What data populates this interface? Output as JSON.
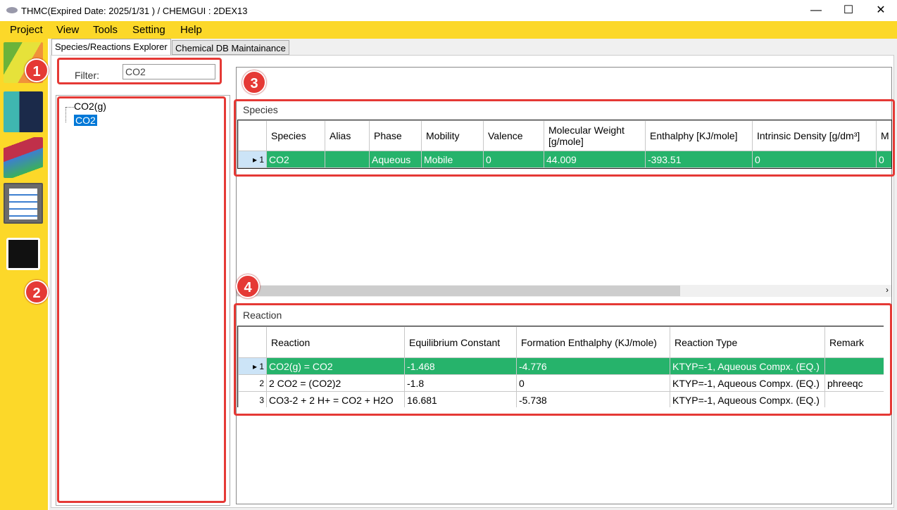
{
  "window": {
    "title": "THMC(Expired Date: 2025/1/31 ) / CHEMGUI : 2DEX13",
    "minimize": "—",
    "maximize": "☐",
    "close": "✕"
  },
  "menu": [
    "Project",
    "View",
    "Tools",
    "Setting",
    "Help"
  ],
  "tabs": [
    "Species/Reactions Explorer",
    "Chemical DB Maintainance"
  ],
  "filter": {
    "label": "Filter:",
    "value": "CO2"
  },
  "tree": [
    "CO2(g)",
    "CO2"
  ],
  "badges": [
    "1",
    "2",
    "3",
    "4"
  ],
  "species": {
    "title": "Species",
    "columns": [
      "Species",
      "Alias",
      "Phase",
      "Mobility",
      "Valence",
      "Molecular Weight [g/mole]",
      "Enthalphy [KJ/mole]",
      "Intrinsic Density [g/dm³]",
      "M [d"
    ],
    "rows": [
      {
        "index": "1",
        "cells": [
          "CO2",
          "",
          "Aqueous",
          "Mobile",
          "0",
          "44.009",
          "-393.51",
          "0",
          "0"
        ]
      }
    ]
  },
  "reaction": {
    "title": "Reaction",
    "columns": [
      "Reaction",
      "Equilibrium Constant",
      "Formation Enthalphy (KJ/mole)",
      "Reaction Type",
      "Remark"
    ],
    "rows": [
      {
        "index": "1",
        "cells": [
          "CO2(g) = CO2",
          "-1.468",
          "-4.776",
          "KTYP=-1, Aqueous Compx. (EQ.)",
          ""
        ]
      },
      {
        "index": "2",
        "cells": [
          "2 CO2 = (CO2)2",
          "-1.8",
          "0",
          "KTYP=-1, Aqueous Compx. (EQ.)",
          "phreeqc"
        ]
      },
      {
        "index": "3",
        "cells": [
          "CO3-2 + 2 H+ = CO2 + H2O",
          "16.681",
          "-5.738",
          "KTYP=-1, Aqueous Compx. (EQ.)",
          ""
        ]
      }
    ]
  },
  "colors": {
    "yellow": "#fcd829",
    "selected_row": "#26b36b",
    "highlight_red": "#e53935",
    "tree_selected": "#0078d7"
  }
}
